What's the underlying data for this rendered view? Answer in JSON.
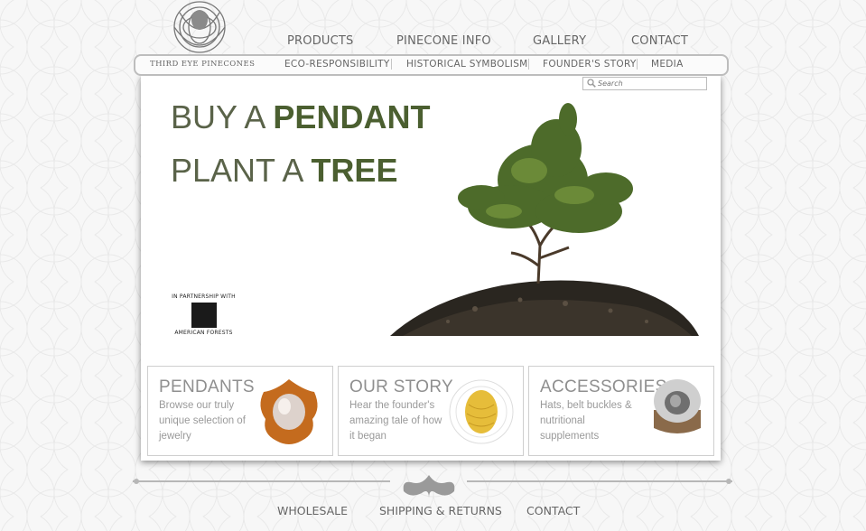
{
  "brand": {
    "name": "THIRD EYE PINECONES"
  },
  "nav": {
    "primary": [
      "PRODUCTS",
      "PINECONE INFO",
      "GALLERY",
      "CONTACT"
    ],
    "secondary": [
      "ECO-RESPONSIBILITY",
      "HISTORICAL SYMBOLISM",
      "FOUNDER'S STORY",
      "MEDIA"
    ]
  },
  "search": {
    "placeholder": "Search"
  },
  "hero": {
    "line1_prefix": "BUY A ",
    "line1_bold": "PENDANT",
    "line2_prefix": "PLANT A ",
    "line2_bold": "TREE"
  },
  "partner": {
    "intro": "IN PARTNERSHIP WITH",
    "name": "AMERICAN FORESTS"
  },
  "cards": [
    {
      "title": "PENDANTS",
      "desc": "Browse our truly unique selection of jewelry"
    },
    {
      "title": "OUR STORY",
      "desc": "Hear the founder's amazing tale of how it began"
    },
    {
      "title": "ACCESSORIES",
      "desc": "Hats, belt buckles & nutritional supplements"
    }
  ],
  "footer": {
    "links": [
      "WHOLESALE",
      "SHIPPING & RETURNS",
      "CONTACT"
    ]
  },
  "colors": {
    "hero_text": "#5a6349",
    "hero_bold": "#4b5f30",
    "nav_text": "#666666",
    "panel_bg": "#ffffff"
  }
}
